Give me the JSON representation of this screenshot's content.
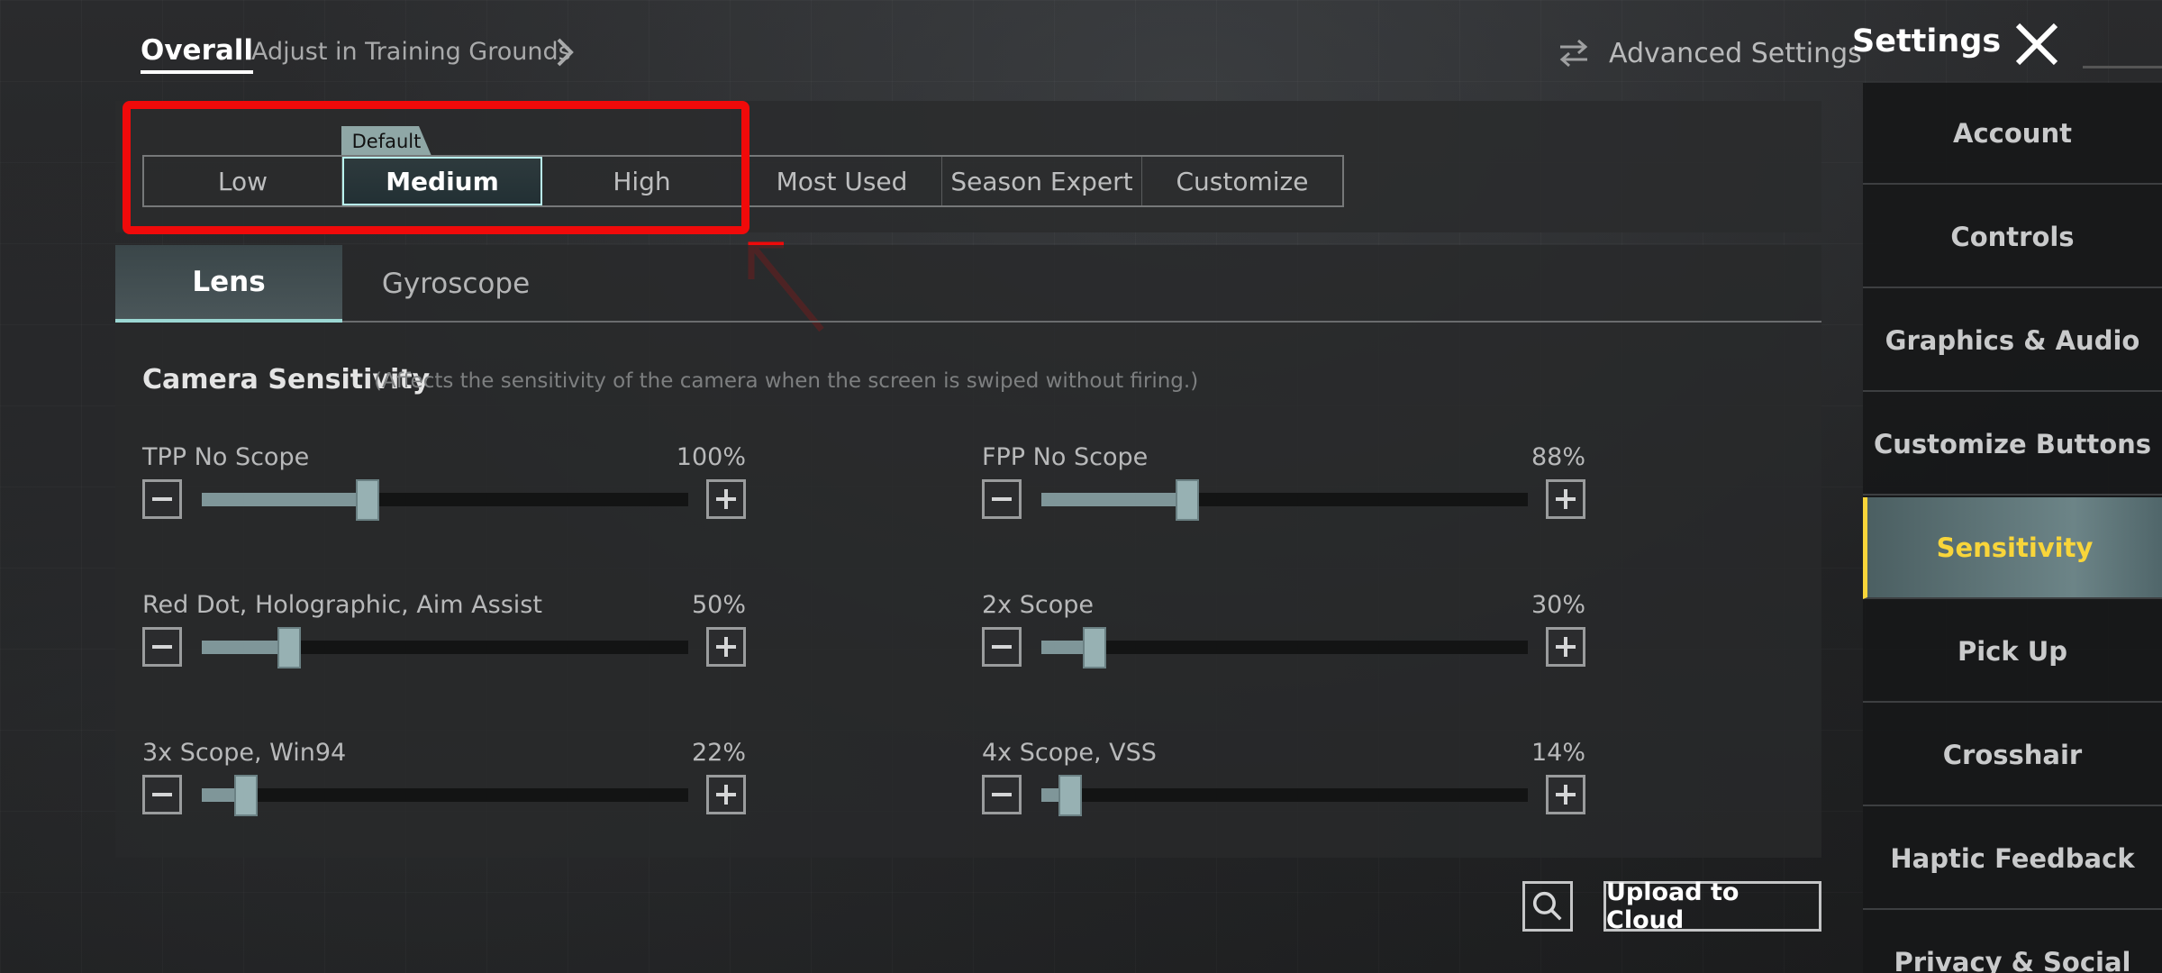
{
  "header": {
    "tabs": [
      {
        "label": "Overall",
        "active": true
      },
      {
        "label": "Adjust in Training Grounds",
        "active": false
      }
    ],
    "advanced_settings": "Advanced Settings",
    "title": "Settings"
  },
  "presets": {
    "default_tag": "Default",
    "items": [
      {
        "label": "Low",
        "active": false
      },
      {
        "label": "Medium",
        "active": true
      },
      {
        "label": "High",
        "active": false
      },
      {
        "label": "Most Used",
        "active": false
      },
      {
        "label": "Season Expert",
        "active": false
      },
      {
        "label": "Customize",
        "active": false
      }
    ]
  },
  "subtabs": [
    {
      "label": "Lens",
      "active": true
    },
    {
      "label": "Gyroscope",
      "active": false
    }
  ],
  "section": {
    "title": "Camera Sensitivity",
    "note": "(Affects the sensitivity of the camera when the screen is swiped without firing.)"
  },
  "sliders": [
    {
      "name": "TPP No Scope",
      "percent_label": "100%",
      "level": 0.34
    },
    {
      "name": "FPP No Scope",
      "percent_label": "88%",
      "level": 0.3
    },
    {
      "name": "Red Dot, Holographic, Aim Assist",
      "percent_label": "50%",
      "level": 0.18
    },
    {
      "name": "2x Scope",
      "percent_label": "30%",
      "level": 0.11
    },
    {
      "name": "3x Scope, Win94",
      "percent_label": "22%",
      "level": 0.09
    },
    {
      "name": "4x Scope, VSS",
      "percent_label": "14%",
      "level": 0.06
    }
  ],
  "footer": {
    "upload_label": "Upload to Cloud"
  },
  "sidebar": {
    "items": [
      {
        "label": "Account",
        "active": false
      },
      {
        "label": "Controls",
        "active": false
      },
      {
        "label": "Graphics & Audio",
        "active": false
      },
      {
        "label": "Customize Buttons",
        "active": false
      },
      {
        "label": "Sensitivity",
        "active": true
      },
      {
        "label": "Pick Up",
        "active": false
      },
      {
        "label": "Crosshair",
        "active": false
      },
      {
        "label": "Haptic Feedback",
        "active": false
      },
      {
        "label": "Privacy & Social",
        "active": false
      }
    ]
  },
  "colors": {
    "accent": "#b9f3ee",
    "highlight_yellow": "#f8d53a",
    "annotation_red": "#f00a0a",
    "slider_fill": "#7f9699"
  }
}
